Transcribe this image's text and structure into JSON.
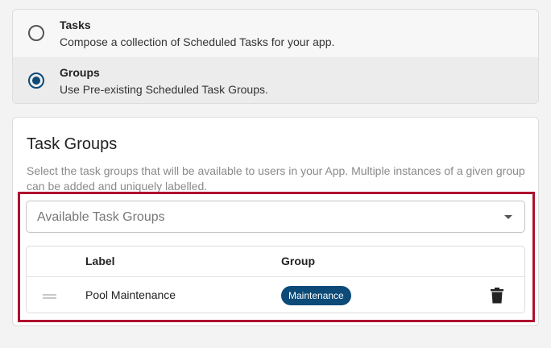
{
  "options": [
    {
      "title": "Tasks",
      "description": "Compose a collection of Scheduled Tasks for your app.",
      "selected": false
    },
    {
      "title": "Groups",
      "description": "Use Pre-existing Scheduled Task Groups.",
      "selected": true
    }
  ],
  "task_groups": {
    "title": "Task Groups",
    "description": "Select the task groups that will be available to users in your App. Multiple instances of a given group can be added and uniquely labelled.",
    "select_placeholder": "Available Task Groups",
    "columns": {
      "label": "Label",
      "group": "Group"
    },
    "rows": [
      {
        "label": "Pool Maintenance",
        "group": "Maintenance"
      }
    ]
  },
  "colors": {
    "accent": "#0c4a78",
    "highlight": "#b0102e"
  },
  "icons": [
    "radio-icon",
    "chevron-down-icon",
    "drag-handle-icon",
    "trash-icon"
  ]
}
